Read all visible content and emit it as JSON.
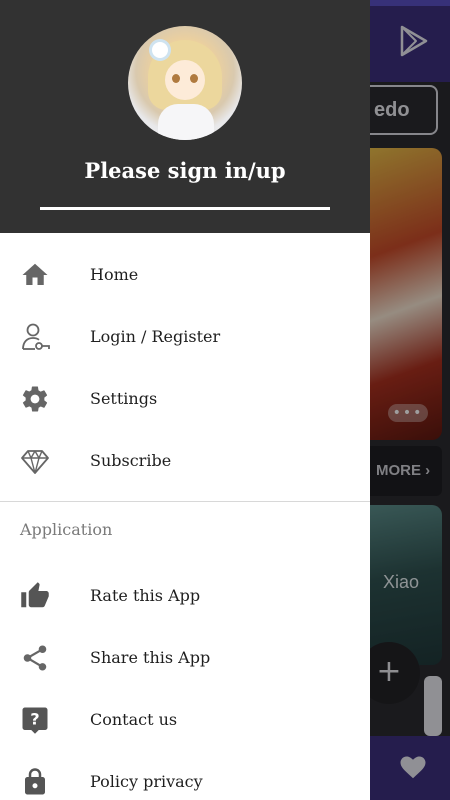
{
  "background_app": {
    "chip_label": "edo",
    "more_label": "MORE",
    "card_label": "Xiao",
    "fab_label": "+"
  },
  "drawer": {
    "header": {
      "sign_in_label": "Please sign in/up"
    },
    "items": [
      {
        "label": "Home",
        "icon": "home-icon"
      },
      {
        "label": "Login / Register",
        "icon": "user-key-icon"
      },
      {
        "label": "Settings",
        "icon": "gear-icon"
      },
      {
        "label": "Subscribe",
        "icon": "diamond-icon"
      }
    ],
    "section_title": "Application",
    "app_items": [
      {
        "label": "Rate this App",
        "icon": "thumbs-up-icon"
      },
      {
        "label": "Share this App",
        "icon": "share-icon"
      },
      {
        "label": "Contact us",
        "icon": "help-icon"
      },
      {
        "label": "Policy privacy",
        "icon": "lock-icon"
      }
    ]
  },
  "colors": {
    "accent": "#3c2f7d",
    "status_bar": "#5a4fc4",
    "header_bg": "#323232",
    "icon_gray": "#666666"
  }
}
